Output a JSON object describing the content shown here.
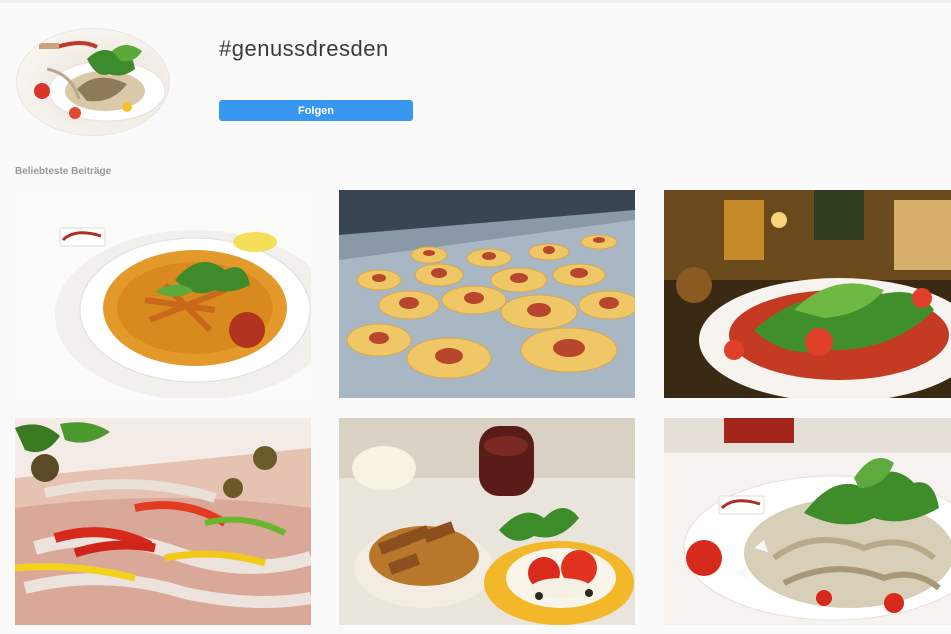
{
  "profile": {
    "hashtag": "#genussdresden",
    "follow_label": "Folgen",
    "avatar_icon": "food-plate-photo"
  },
  "posts_section": {
    "heading": "Beliebteste Beiträge",
    "posts": [
      {
        "subject": "soup-bowl-photo",
        "logo_text": "Bruuus!"
      },
      {
        "subject": "ravioli-dough-photo"
      },
      {
        "subject": "salad-plate-restaurant-photo"
      },
      {
        "subject": "carpaccio-peppers-photo"
      },
      {
        "subject": "bread-and-caprese-photo"
      },
      {
        "subject": "pasta-salad-photo",
        "logo_text": "Bruuus!"
      }
    ]
  },
  "colors": {
    "accent": "#3897f0",
    "background": "#fafafa",
    "heading_text": "#999999",
    "title_text": "#3a3a3a"
  }
}
